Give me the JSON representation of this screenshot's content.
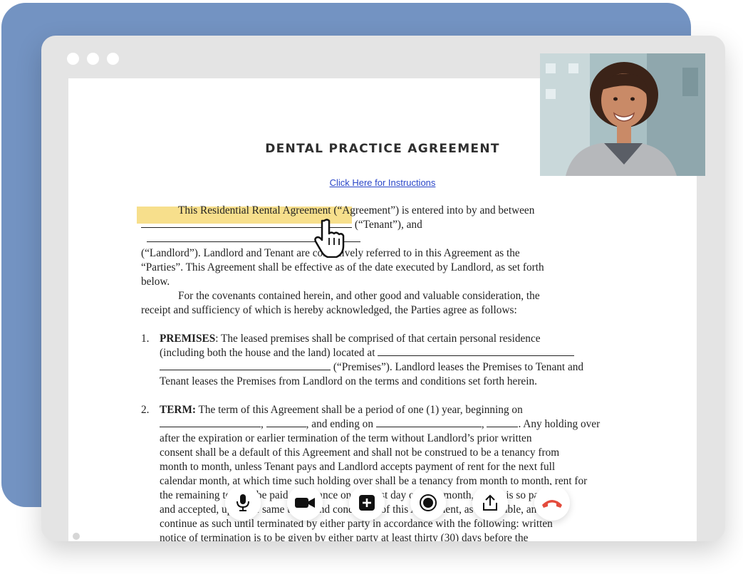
{
  "window": {
    "title_dots": [
      "close",
      "minimize",
      "maximize"
    ]
  },
  "document": {
    "title": "DENTAL PRACTICE AGREEMENT",
    "instructions_link": "Click Here for Instructions",
    "paragraph1": {
      "line1": "This Residential Rental Agreement (“Agreement”) is entered into by and between",
      "line2_end": "(“Tenant”), and",
      "line3": "(“Landlord”). Landlord and Tenant are collectively referred to in this Agreement as the",
      "line4": "“Parties”. This Agreement shall be effective as of the date executed by Landlord, as set forth",
      "line5": "below."
    },
    "paragraph2": {
      "line1": "For the covenants contained herein, and other good and valuable consideration, the",
      "line2": "receipt and sufficiency of which is hereby acknowledged, the Parties agree as follows:"
    },
    "items": [
      {
        "number": "1.",
        "heading": "PREMISES",
        "line1": ":  The leased premises shall be comprised of that certain personal residence",
        "line2": "(including both the house and the land) located at",
        "line3": "(“Premises”). Landlord leases the Premises to Tenant and",
        "line4": "Tenant leases the Premises from Landlord on the terms and conditions set forth herein."
      },
      {
        "number": "2.",
        "heading": "TERM:",
        "line1": " The term of this Agreement shall be a period of one (1) year, beginning on",
        "line2a": ", and ending on",
        "line2b": ". Any holding over",
        "line3": "after the expiration or earlier termination of the term without Landlord’s prior written",
        "line4": "consent shall be a default of this Agreement and shall not be construed to be a tenancy from",
        "line5": "month to month, unless Tenant pays and Landlord accepts payment of rent for the next full",
        "line6": "calendar month, at which time such holding over shall be a tenancy from month to month, rent for",
        "line7": "the remaining term to be paid in advance on the first day of each month, which is so paid",
        "line8": "and accepted, upon the same terms and conditions of this Agreement, as applicable, and will",
        "line9": "continue as such until terminated by either party in accordance with the following: written",
        "line10": "notice of termination is to be given by either party at least thirty (30) days before the"
      }
    ]
  },
  "call_controls": [
    {
      "name": "microphone-button",
      "icon": "microphone-icon"
    },
    {
      "name": "camera-button",
      "icon": "video-camera-icon"
    },
    {
      "name": "add-button",
      "icon": "plus-square-icon"
    },
    {
      "name": "record-button",
      "icon": "record-icon"
    },
    {
      "name": "share-button",
      "icon": "share-upload-icon"
    },
    {
      "name": "end-call-button",
      "icon": "phone-hangup-icon",
      "color": "#e34b3c"
    }
  ],
  "colors": {
    "backdrop": "#7393c2",
    "highlight": "#f6d978",
    "link": "#2a46c8",
    "end_call": "#e34b3c"
  }
}
